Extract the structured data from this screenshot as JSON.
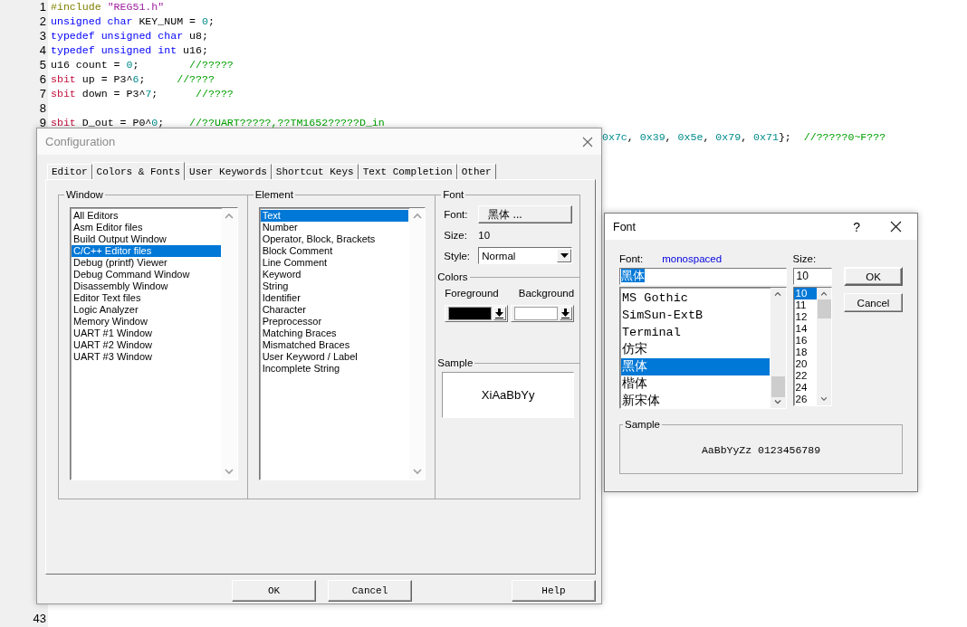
{
  "editor": {
    "lines": [
      {
        "number": "1",
        "tokens": [
          {
            "kind": "preprocessor",
            "text": "#include "
          },
          {
            "kind": "string",
            "text": "\"REG51.h\""
          }
        ]
      },
      {
        "number": "2",
        "tokens": [
          {
            "kind": "keyword",
            "text": "unsigned char"
          },
          {
            "kind": "plain",
            "text": " KEY_NUM = "
          },
          {
            "kind": "number",
            "text": "0"
          },
          {
            "kind": "plain",
            "text": ";"
          }
        ]
      },
      {
        "number": "3",
        "tokens": [
          {
            "kind": "keyword",
            "text": "typedef unsigned char"
          },
          {
            "kind": "plain",
            "text": " u8;"
          }
        ]
      },
      {
        "number": "4",
        "tokens": [
          {
            "kind": "keyword",
            "text": "typedef unsigned int"
          },
          {
            "kind": "plain",
            "text": " u16;"
          }
        ]
      },
      {
        "number": "5",
        "tokens": [
          {
            "kind": "plain",
            "text": "u16 count = "
          },
          {
            "kind": "number",
            "text": "0"
          },
          {
            "kind": "plain",
            "text": ";        "
          },
          {
            "kind": "comment",
            "text": "//?????"
          }
        ]
      },
      {
        "number": "6",
        "tokens": [
          {
            "kind": "sfr",
            "text": "sbit"
          },
          {
            "kind": "plain",
            "text": " up = P3^"
          },
          {
            "kind": "number",
            "text": "6"
          },
          {
            "kind": "plain",
            "text": ";     "
          },
          {
            "kind": "comment",
            "text": "//????"
          }
        ]
      },
      {
        "number": "7",
        "tokens": [
          {
            "kind": "sfr",
            "text": "sbit"
          },
          {
            "kind": "plain",
            "text": " down = P3^"
          },
          {
            "kind": "number",
            "text": "7"
          },
          {
            "kind": "plain",
            "text": ";      "
          },
          {
            "kind": "comment",
            "text": "//????"
          }
        ]
      },
      {
        "number": "8"
      },
      {
        "number": "9",
        "tokens": [
          {
            "kind": "sfr",
            "text": "sbit"
          },
          {
            "kind": "plain",
            "text": " D_out = P0^"
          },
          {
            "kind": "number",
            "text": "0"
          },
          {
            "kind": "plain",
            "text": ";    "
          },
          {
            "kind": "comment",
            "text": "//??UART?????,??TM1652?????D_in"
          }
        ]
      }
    ],
    "partial_line": {
      "tokens": [
        {
          "kind": "number",
          "text": "0x7c"
        },
        {
          "kind": "plain",
          "text": ", "
        },
        {
          "kind": "number",
          "text": "0x39"
        },
        {
          "kind": "plain",
          "text": ", "
        },
        {
          "kind": "number",
          "text": "0x5e"
        },
        {
          "kind": "plain",
          "text": ", "
        },
        {
          "kind": "number",
          "text": "0x79"
        },
        {
          "kind": "plain",
          "text": ", "
        },
        {
          "kind": "number",
          "text": "0x71"
        },
        {
          "kind": "plain",
          "text": "};  "
        },
        {
          "kind": "comment",
          "text": "//?????0~F???"
        }
      ]
    },
    "bottom_lines": [
      {
        "number": "43"
      }
    ]
  },
  "configuration": {
    "title": "Configuration",
    "tabs": [
      {
        "label": "Editor",
        "selected": false
      },
      {
        "label": "Colors & Fonts",
        "selected": true
      },
      {
        "label": "User Keywords",
        "selected": false
      },
      {
        "label": "Shortcut Keys",
        "selected": false
      },
      {
        "label": "Text Completion",
        "selected": false
      },
      {
        "label": "Other",
        "selected": false
      }
    ],
    "window_group": {
      "label": "Window",
      "items": [
        {
          "label": "All Editors",
          "selected": false
        },
        {
          "label": "Asm Editor files",
          "selected": false
        },
        {
          "label": "Build Output Window",
          "selected": false
        },
        {
          "label": "C/C++ Editor files",
          "selected": true
        },
        {
          "label": "Debug (printf) Viewer",
          "selected": false
        },
        {
          "label": "Debug Command Window",
          "selected": false
        },
        {
          "label": "Disassembly Window",
          "selected": false
        },
        {
          "label": "Editor Text files",
          "selected": false
        },
        {
          "label": "Logic Analyzer",
          "selected": false
        },
        {
          "label": "Memory Window",
          "selected": false
        },
        {
          "label": "UART #1 Window",
          "selected": false
        },
        {
          "label": "UART #2 Window",
          "selected": false
        },
        {
          "label": "UART #3 Window",
          "selected": false
        }
      ]
    },
    "element_group": {
      "label": "Element",
      "items": [
        {
          "label": "Text",
          "selected": true
        },
        {
          "label": "Number",
          "selected": false
        },
        {
          "label": "Operator, Block, Brackets",
          "selected": false
        },
        {
          "label": "Block Comment",
          "selected": false
        },
        {
          "label": "Line Comment",
          "selected": false
        },
        {
          "label": "Keyword",
          "selected": false
        },
        {
          "label": "String",
          "selected": false
        },
        {
          "label": "Identifier",
          "selected": false
        },
        {
          "label": "Character",
          "selected": false
        },
        {
          "label": "Preprocessor",
          "selected": false
        },
        {
          "label": "Matching Braces",
          "selected": false
        },
        {
          "label": "Mismatched Braces",
          "selected": false
        },
        {
          "label": "User Keyword / Label",
          "selected": false
        },
        {
          "label": "Incomplete String",
          "selected": false
        }
      ]
    },
    "font_group": {
      "label": "Font",
      "font_label": "Font:",
      "font_button": "黑体 ...",
      "size_label": "Size:",
      "size_value": "10",
      "style_label": "Style:",
      "style_value": "Normal"
    },
    "colors_group": {
      "label": "Colors",
      "foreground_label": "Foreground",
      "background_label": "Background"
    },
    "sample_group": {
      "label": "Sample",
      "text": "XiAaBbYy"
    },
    "buttons": [
      "OK",
      "Cancel",
      "Help"
    ]
  },
  "font_dialog": {
    "title": "Font",
    "help": "?",
    "font_label": "Font:",
    "font_note": "monospaced",
    "font_value": "黑体",
    "size_label": "Size:",
    "size_value": "10",
    "fonts": [
      {
        "label": "MS Gothic",
        "selected": false
      },
      {
        "label": "SimSun-ExtB",
        "selected": false
      },
      {
        "label": "Terminal",
        "selected": false
      },
      {
        "label": "仿宋",
        "selected": false
      },
      {
        "label": "黑体",
        "selected": true
      },
      {
        "label": "楷体",
        "selected": false
      },
      {
        "label": "新宋体",
        "selected": false
      }
    ],
    "sizes": [
      {
        "label": "10",
        "selected": true
      },
      {
        "label": "11",
        "selected": false
      },
      {
        "label": "12",
        "selected": false
      },
      {
        "label": "14",
        "selected": false
      },
      {
        "label": "16",
        "selected": false
      },
      {
        "label": "18",
        "selected": false
      },
      {
        "label": "20",
        "selected": false
      },
      {
        "label": "22",
        "selected": false
      },
      {
        "label": "24",
        "selected": false
      },
      {
        "label": "26",
        "selected": false
      }
    ],
    "buttons": [
      "OK",
      "Cancel"
    ],
    "sample_label": "Sample",
    "sample_text": "AaBbYyZz 0123456789"
  }
}
